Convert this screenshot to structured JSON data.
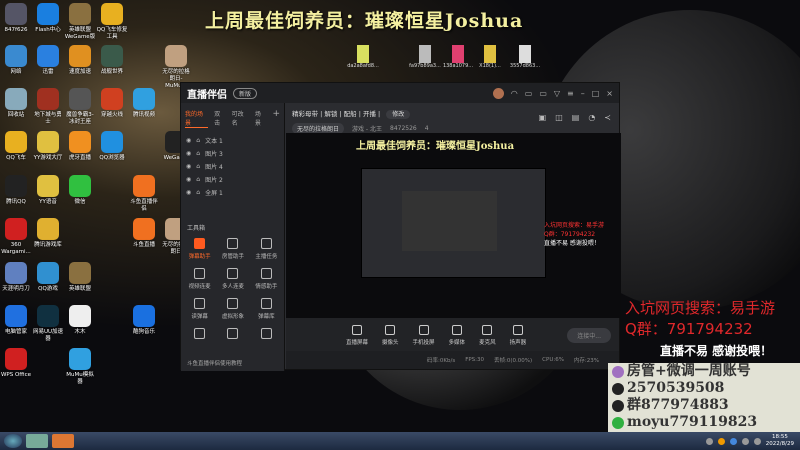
{
  "banner": "上周最佳饲养员：璀璨恒星Joshua",
  "desktop_rows": [
    [
      {
        "label": "847f626",
        "color": "#556"
      },
      {
        "label": "Flash中心",
        "color": "#1a7fe0"
      },
      {
        "label": "英雄联盟WeGame版",
        "color": "#8a7040"
      },
      {
        "label": "QQ飞车修复工具",
        "color": "#e8b020"
      },
      null,
      null
    ],
    [
      {
        "label": "网络",
        "color": "#3a8ad0"
      },
      {
        "label": "迅雷",
        "color": "#2a80e0"
      },
      {
        "label": "速度加速",
        "color": "#e09020"
      },
      {
        "label": "战舰世界",
        "color": "#3a5a4a"
      },
      null,
      {
        "label": "无尽的拉格朗日-MuMu...",
        "color": "#c0a080"
      }
    ],
    [
      {
        "label": "回收站",
        "color": "#8ab"
      },
      {
        "label": "地下城与勇士",
        "color": "#a03020"
      },
      {
        "label": "魔兽争霸3-冰封王座",
        "color": "#555"
      },
      {
        "label": "穿越火线",
        "color": "#d04020"
      },
      {
        "label": "腾讯视频",
        "color": "#30a0e0"
      },
      null
    ],
    [
      {
        "label": "QQ飞车",
        "color": "#e8b020"
      },
      {
        "label": "YY游戏大厅",
        "color": "#e0c040"
      },
      {
        "label": "虎牙直播",
        "color": "#f09020"
      },
      {
        "label": "QQ浏览器",
        "color": "#2090e0"
      },
      null,
      {
        "label": "WeGame",
        "color": "#222"
      }
    ],
    [
      {
        "label": "腾讯QQ",
        "color": "#222"
      },
      {
        "label": "YY语音",
        "color": "#e0c040"
      },
      {
        "label": "微信",
        "color": "#30c040"
      },
      null,
      {
        "label": "斗鱼直播伴侣",
        "color": "#f07020"
      },
      null
    ],
    [
      {
        "label": "360 Wargami...",
        "color": "#d02020"
      },
      {
        "label": "腾讯游戏库",
        "color": "#e0b030"
      },
      null,
      null,
      {
        "label": "斗鱼直播",
        "color": "#f07020"
      },
      {
        "label": "无尽的拉格朗日",
        "color": "#c0a080"
      }
    ],
    [
      {
        "label": "天涯明月刀",
        "color": "#6080c0"
      },
      {
        "label": "QQ游戏",
        "color": "#3090d0"
      },
      {
        "label": "英雄联盟",
        "color": "#8a7040"
      },
      null,
      null,
      null
    ],
    [
      {
        "label": "电脑管家",
        "color": "#2070e0"
      },
      {
        "label": "网易UU加速器",
        "color": "#103040"
      },
      {
        "label": "木木",
        "color": "#eee"
      },
      null,
      {
        "label": "酷狗音乐",
        "color": "#1a70e0"
      },
      null
    ],
    [
      {
        "label": "WPS Office",
        "color": "#d02020"
      },
      null,
      {
        "label": "MuMu模拟器",
        "color": "#30a0e0"
      },
      null,
      null,
      null
    ]
  ],
  "files": [
    {
      "label": "da2a8afd8...",
      "color": "#d8e060"
    },
    {
      "label": "fa97b89a3...",
      "color": "#bbb"
    },
    {
      "label": "138a1079...",
      "color": "#e04070"
    },
    {
      "label": "X18(1)...",
      "color": "#e0c040"
    },
    {
      "label": "3557d863...",
      "color": "#ddd"
    }
  ],
  "app": {
    "name": "直播伴侣",
    "version": "新版",
    "scene_tabs": [
      "我的场景",
      "双击",
      "可改名",
      "场景"
    ],
    "add": "+",
    "sources": [
      "文本 1",
      "图片 3",
      "图片 4",
      "图片 2",
      "全屏 1"
    ],
    "toolbox_title": "工具箱",
    "tools": [
      "弹幕助手",
      "房管助手",
      "主播任务",
      "视频连麦",
      "多人连麦",
      "情感助手",
      "读弹幕",
      "虚拟形象",
      "弹幕库",
      "",
      "",
      ""
    ],
    "tutorial": "斗鱼直播伴侣使用教程",
    "room_title": "精彩母带 | 解锁 | 配船 | 开播 |",
    "edit": "修改",
    "game_tag": "无尽的拉格朗日",
    "category": "游戏 - 北王",
    "room_id": "8472526",
    "fans": "4",
    "preview_banner": "上周最佳饲养员：璀璨恒星Joshua",
    "preview_text": [
      "入坑网页搜索：易手游",
      "Q群：791794232",
      "直播不易 感谢投喂！"
    ],
    "toolbar": [
      "直播屏幕",
      "摄像头",
      "手机投屏",
      "多媒体",
      "麦克风",
      "扬声器"
    ],
    "live_button": "连接中...",
    "status": [
      "码率:0Kb/s",
      "FPS:30",
      "丢帧:0(0.00%)",
      "CPU:6%",
      "内存:23%"
    ]
  },
  "overlay": {
    "search": "入坑网页搜索：易手游",
    "qq_group": "Q群：791794232",
    "thanks": "直播不易 感谢投喂！",
    "card": [
      "房管+微调一周账号",
      "2570539508",
      "群877974883",
      "moyu779119823"
    ]
  },
  "taskbar": {
    "time": "18:55",
    "date": "2022/8/29"
  }
}
